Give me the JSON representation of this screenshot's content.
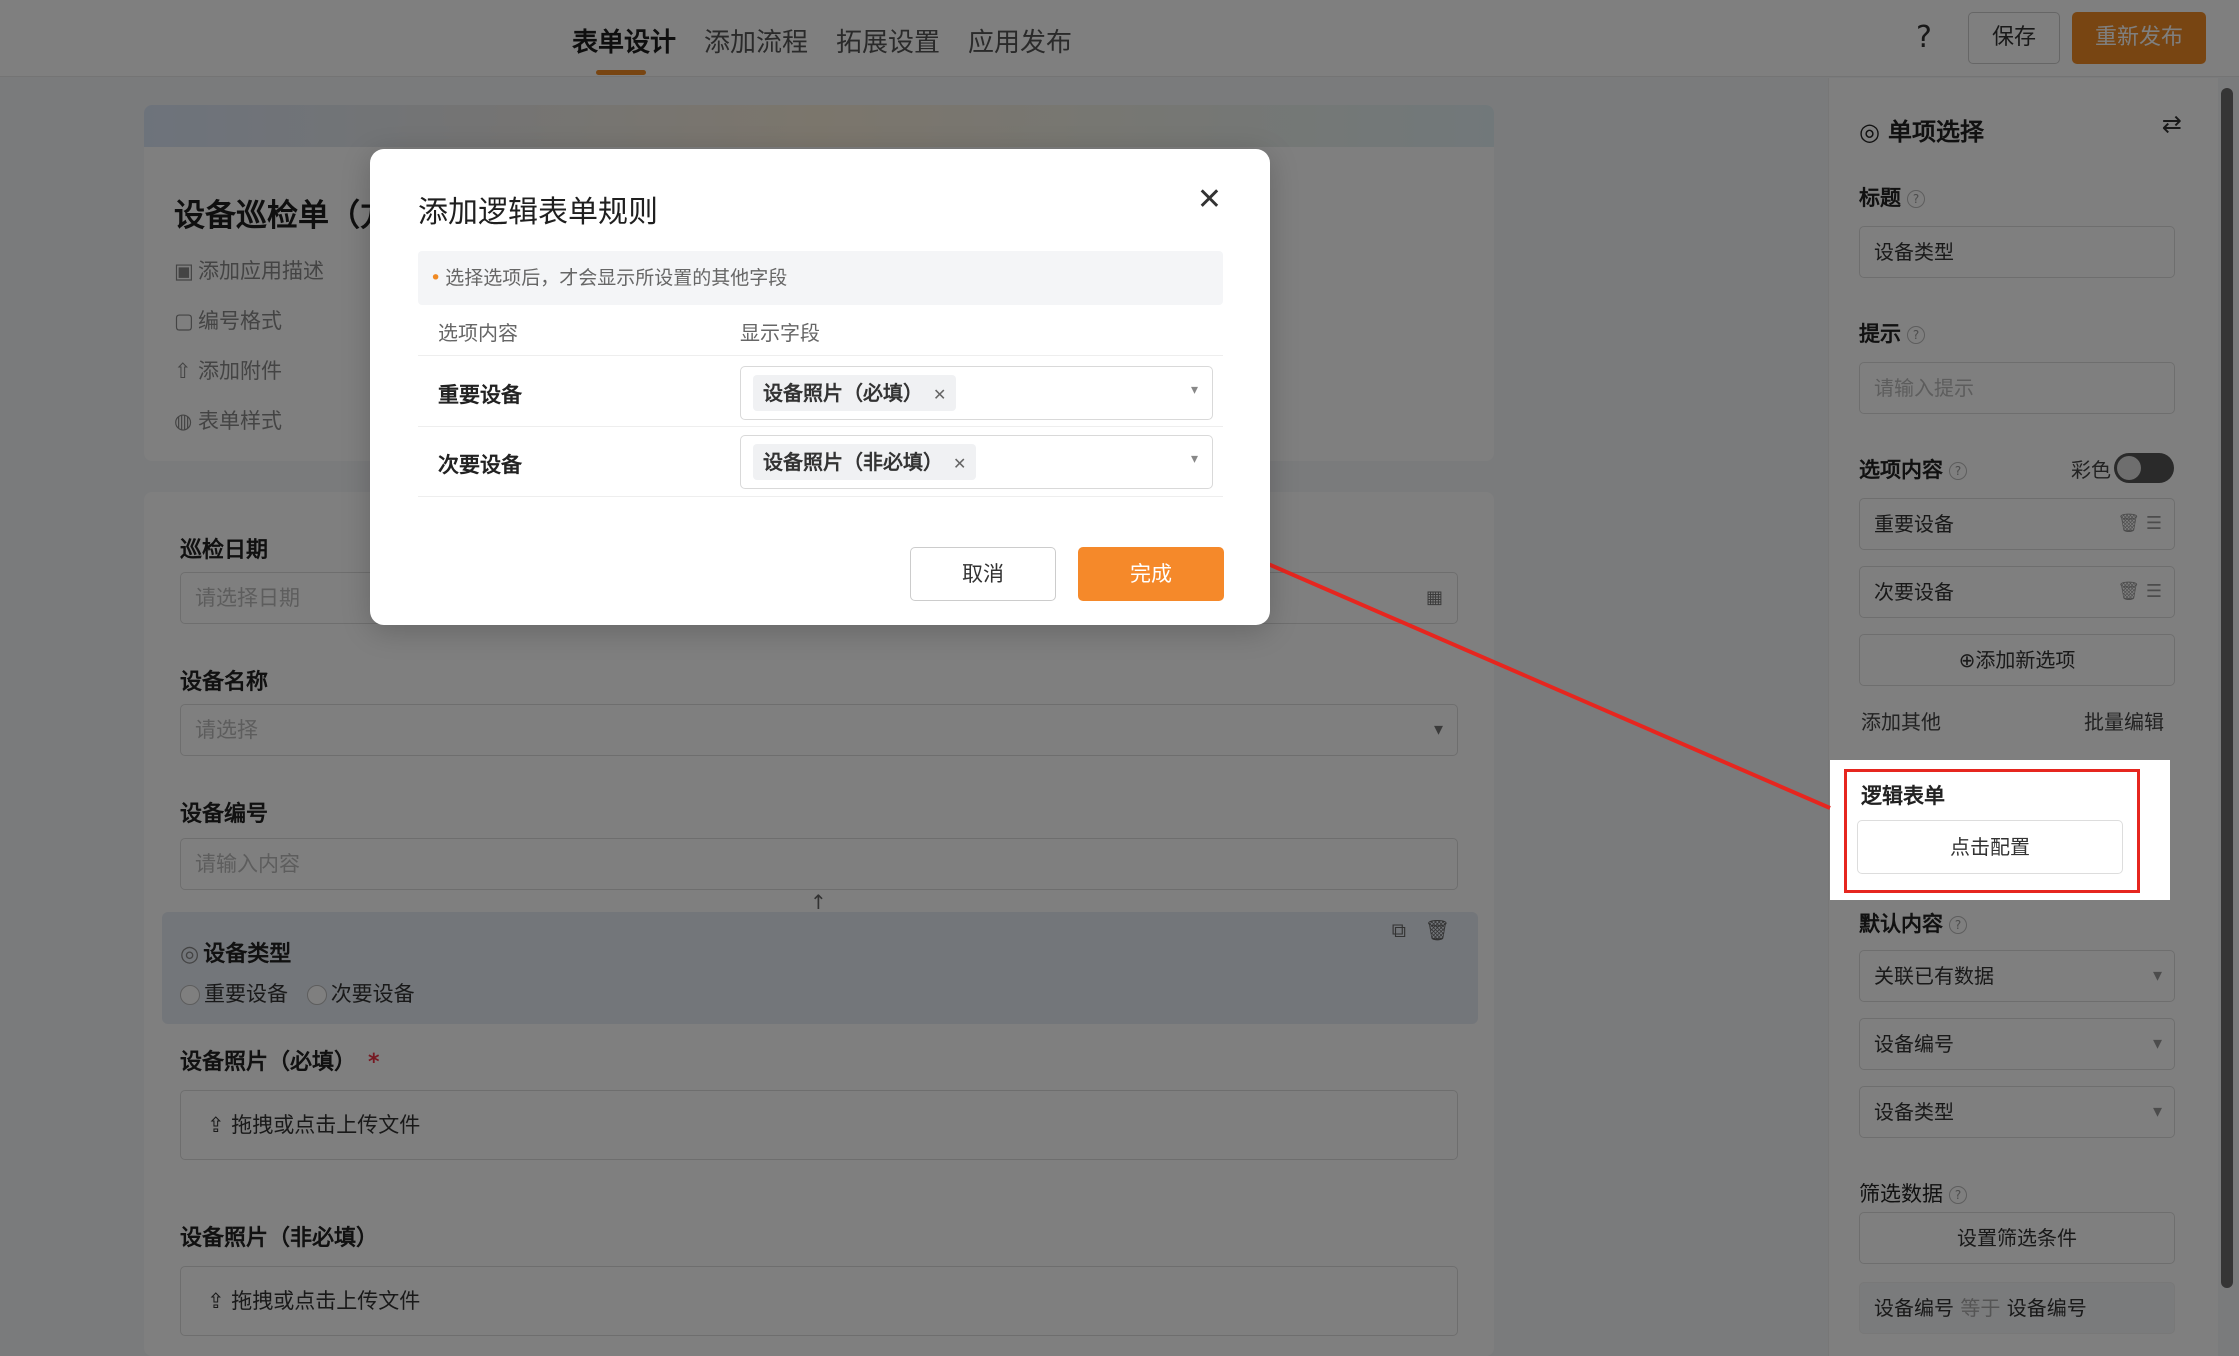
{
  "header": {
    "tabs": [
      "表单设计",
      "添加流程",
      "拓展设置",
      "应用发布"
    ],
    "help_icon": "?",
    "save_label": "保存",
    "republish_label": "重新发布"
  },
  "form_header": {
    "title": "设备巡检单（方",
    "meta": [
      "添加应用描述",
      "编号格式",
      "添加附件",
      "表单样式"
    ]
  },
  "form": {
    "date_label": "巡检日期",
    "date_placeholder": "请选择日期",
    "name_label": "设备名称",
    "name_placeholder": "请选择",
    "code_label": "设备编号",
    "code_placeholder": "请输入内容",
    "type_label": "设备类型",
    "type_options": [
      "重要设备",
      "次要设备"
    ],
    "photo_required_label": "设备照片（必填）",
    "required_mark": "*",
    "upload_text": "拖拽或点击上传文件",
    "photo_optional_label": "设备照片（非必填）"
  },
  "right_panel": {
    "title": "单项选择",
    "title_label": "标题",
    "title_value": "设备类型",
    "hint_label": "提示",
    "hint_placeholder": "请输入提示",
    "options_label": "选项内容",
    "color_label": "彩色",
    "options": [
      "重要设备",
      "次要设备"
    ],
    "add_option": "添加新选项",
    "add_other": "添加其他",
    "batch_edit": "批量编辑",
    "logic_label": "逻辑表单",
    "logic_button": "点击配置",
    "default_label": "默认内容",
    "default_values": [
      "关联已有数据",
      "设备编号",
      "设备类型"
    ],
    "filter_label": "筛选数据",
    "filter_button": "设置筛选条件",
    "filter_rule": {
      "left": "设备编号",
      "op": "等于",
      "right": "设备编号"
    }
  },
  "modal": {
    "title": "添加逻辑表单规则",
    "tip": "选择选项后，才会显示所设置的其他字段",
    "col_option": "选项内容",
    "col_field": "显示字段",
    "rows": [
      {
        "option": "重要设备",
        "field": "设备照片（必填）"
      },
      {
        "option": "次要设备",
        "field": "设备照片（非必填）"
      }
    ],
    "cancel": "取消",
    "done": "完成"
  },
  "colors": {
    "accent": "#f08a24",
    "highlight": "#e6261f"
  }
}
